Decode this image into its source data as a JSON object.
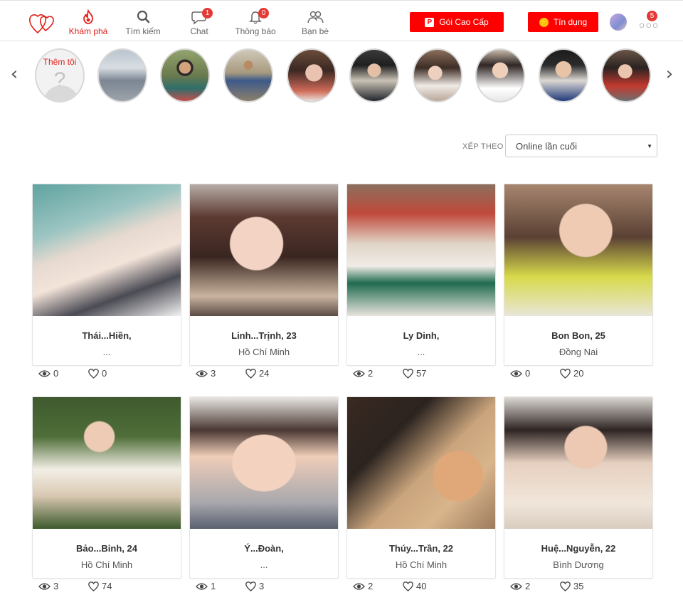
{
  "nav": {
    "items": [
      {
        "label": "Khám phá",
        "icon": "flame-icon"
      },
      {
        "label": "Tìm kiếm",
        "icon": "search-icon"
      },
      {
        "label": "Chat",
        "icon": "chat-bubble-icon",
        "badge": "1"
      },
      {
        "label": "Thông báo",
        "icon": "bell-icon",
        "badge": "0"
      },
      {
        "label": "Bạn bè",
        "icon": "friends-icon"
      }
    ],
    "premium_label": "Gói Cao Cấp",
    "credit_label": "Tín dụng",
    "more_badge": "5"
  },
  "strip": {
    "add_me_label": "Thêm tôi",
    "avatars": [
      {
        "icon": "avatar-1"
      },
      {
        "icon": "avatar-2"
      },
      {
        "icon": "avatar-3"
      },
      {
        "icon": "avatar-4"
      },
      {
        "icon": "avatar-5"
      },
      {
        "icon": "avatar-6"
      },
      {
        "icon": "avatar-7"
      },
      {
        "icon": "avatar-8"
      },
      {
        "icon": "avatar-9"
      }
    ]
  },
  "sort": {
    "label": "XẾP THEO",
    "selected": "Online lần cuối"
  },
  "profiles": [
    {
      "name": "Thái...Hiền,",
      "city": "...",
      "views": "0",
      "likes": "0"
    },
    {
      "name": "Linh...Trịnh, 23",
      "city": "Hồ Chí Minh",
      "views": "3",
      "likes": "24"
    },
    {
      "name": "Ly Dinh,",
      "city": "...",
      "views": "2",
      "likes": "57"
    },
    {
      "name": "Bon Bon, 25",
      "city": "Đồng Nai",
      "views": "0",
      "likes": "20"
    },
    {
      "name": "Bảo...Binh, 24",
      "city": "Hồ Chí Minh",
      "views": "3",
      "likes": "74"
    },
    {
      "name": "Ý...Đoàn,",
      "city": "...",
      "views": "1",
      "likes": "3"
    },
    {
      "name": "Thúy...Trần, 22",
      "city": "Hồ Chí Minh",
      "views": "2",
      "likes": "40"
    },
    {
      "name": "Huệ...Nguyễn, 22",
      "city": "Bình Dương",
      "views": "2",
      "likes": "35"
    }
  ],
  "colors": {
    "accent": "#ff0000",
    "active_nav": "#e0201b",
    "badge": "#e53935"
  }
}
